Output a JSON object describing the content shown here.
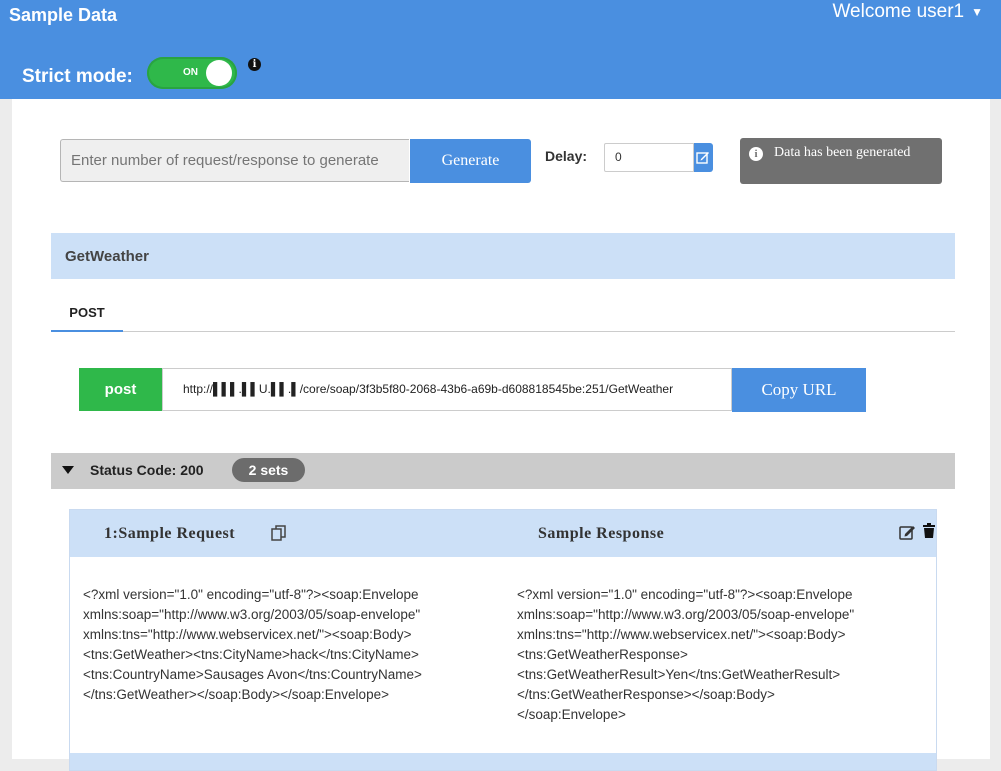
{
  "header": {
    "app_title": "Sample Data",
    "welcome": "Welcome user1",
    "strict_label": "Strict mode:",
    "toggle_state": "ON",
    "info_glyph": "i"
  },
  "generate": {
    "placeholder": "Enter number of request/response to generate",
    "button_label": "Generate",
    "delay_label": "Delay:",
    "delay_value": "0"
  },
  "toast": {
    "icon_glyph": "i",
    "message": "Data has been generated"
  },
  "operation": {
    "name": "GetWeather",
    "method_tab": "POST",
    "method_badge": "post",
    "url": "http://▌▌▌.▌▌U.▌▌.▌/core/soap/3f3b5f80-2068-43b6-a69b-d608818545be:251/GetWeather",
    "copy_label": "Copy URL"
  },
  "status": {
    "label": "Status Code: 200",
    "sets": "2 sets"
  },
  "sample": {
    "request_title": "1:Sample Request",
    "response_title": "Sample Response",
    "request_body": "<?xml version=\"1.0\" encoding=\"utf-8\"?><soap:Envelope\nxmlns:soap=\"http://www.w3.org/2003/05/soap-envelope\"\nxmlns:tns=\"http://www.webservicex.net/\"><soap:Body>\n<tns:GetWeather><tns:CityName>hack</tns:CityName>\n<tns:CountryName>Sausages Avon</tns:CountryName>\n</tns:GetWeather></soap:Body></soap:Envelope>",
    "response_body": "<?xml version=\"1.0\" encoding=\"utf-8\"?><soap:Envelope\nxmlns:soap=\"http://www.w3.org/2003/05/soap-envelope\"\nxmlns:tns=\"http://www.webservicex.net/\"><soap:Body>\n<tns:GetWeatherResponse>\n<tns:GetWeatherResult>Yen</tns:GetWeatherResult>\n</tns:GetWeatherResponse></soap:Body>\n</soap:Envelope>"
  },
  "icons": {
    "info": "info-icon",
    "edit": "edit-icon",
    "copy": "copy-icon",
    "delete": "trash-icon",
    "expand": "triangle-down-icon",
    "dropdown": "caret-down-icon"
  },
  "colors": {
    "header_blue": "#4a8fe0",
    "toggle_green": "#2fb84a",
    "post_green": "#2fb84a",
    "light_blue": "#cce0f7",
    "status_gray": "#cbcbcb",
    "toast_gray": "#707070"
  }
}
